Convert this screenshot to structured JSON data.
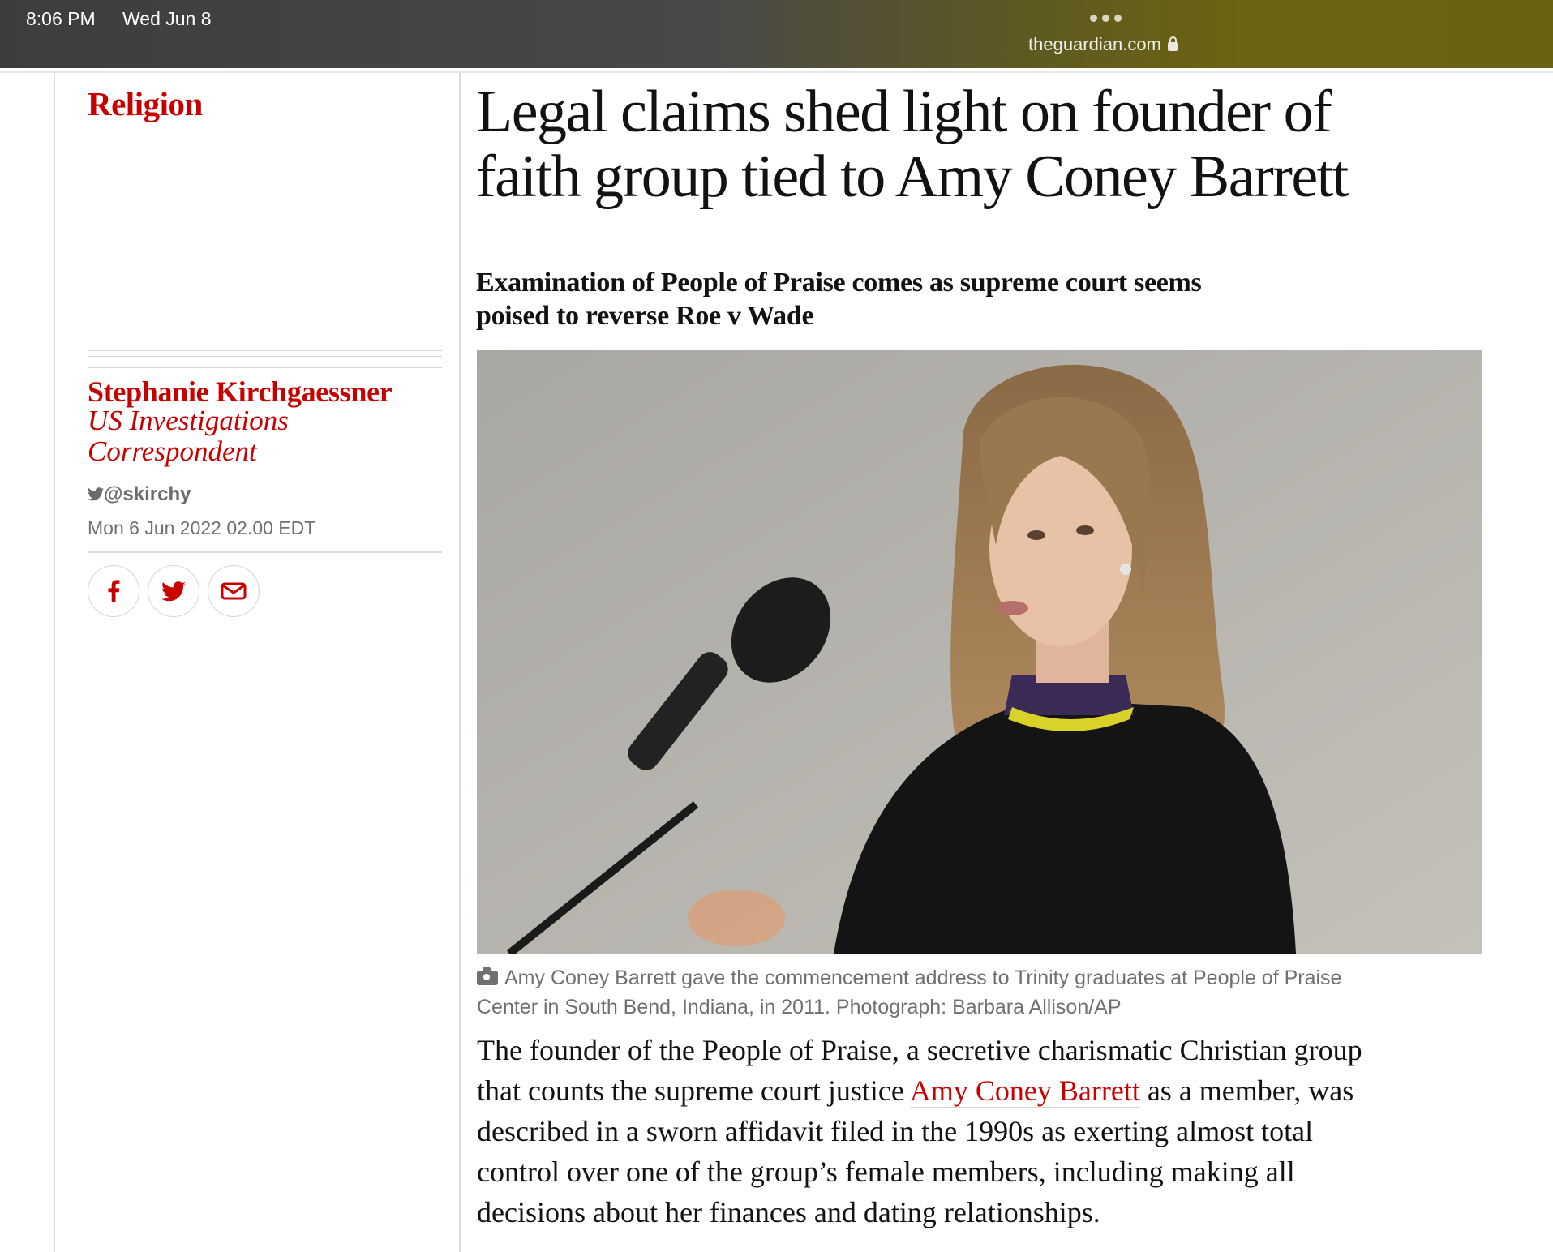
{
  "status_bar": {
    "time": "8:06 PM",
    "date": "Wed Jun 8"
  },
  "browser": {
    "url": "theguardian.com"
  },
  "article": {
    "section": "Religion",
    "headline_line1": "Legal claims shed light on founder of",
    "headline_line2": "faith group tied to Amy Coney Barrett",
    "standfirst_line1": "Examination of People of Praise comes as supreme court seems",
    "standfirst_line2": "poised to reverse Roe v Wade",
    "author": "Stephanie Kirchgaessner",
    "role_line1": "US Investigations",
    "role_line2": "Correspondent",
    "twitter_handle": "@skirchy",
    "dateline": "Mon 6 Jun 2022 02.00 EDT",
    "caption_line1": "Amy Coney Barrett gave the commencement address to Trinity graduates at People of Praise",
    "caption_line2": "Center in South Bend, Indiana, in 2011. Photograph: Barbara Allison/AP",
    "body_1a": "The founder of the People of Praise, a secretive charismatic Christian group",
    "body_2a": "that counts the supreme court justice ",
    "body_link": "Amy Coney Barrett",
    "body_2b": " as a member, was",
    "body_3": "described in a sworn affidavit filed in the 1990s as exerting almost total",
    "body_4": "control over one of the group’s female members, including making all",
    "body_5": "decisions about her finances and dating relationships."
  },
  "share_icons": [
    "facebook-icon",
    "twitter-icon",
    "email-icon"
  ],
  "colors": {
    "accent": "#c70000",
    "text": "#121212",
    "muted": "#707070"
  }
}
